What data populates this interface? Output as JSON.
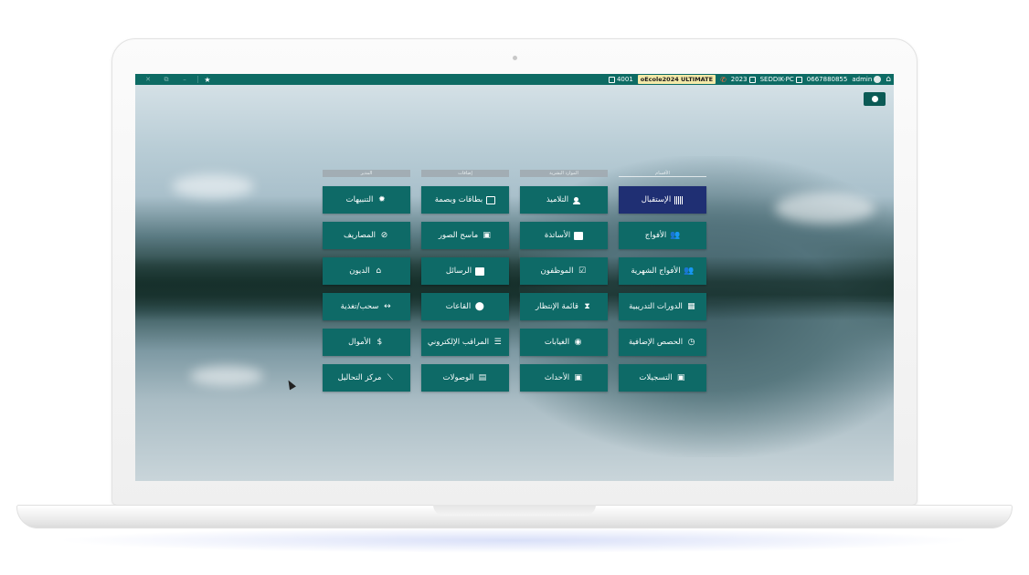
{
  "topbar": {
    "window_controls": [
      "✕",
      "⧉",
      "–"
    ],
    "star": "★",
    "count": "4001",
    "product": "oEcole2024 ULTIMATE",
    "year": "2023",
    "computer": "SEDDIK-PC",
    "phone": "0667880855",
    "user": "admin",
    "home": "⌂"
  },
  "columns": [
    {
      "heading": "الأقسام",
      "tiles": [
        {
          "label": "الإستقبال",
          "icon": "barcode-icon",
          "glyph": ""
        },
        {
          "label": "الأفواج",
          "icon": "group-icon",
          "glyph": "👥"
        },
        {
          "label": "الأفواج الشهرية",
          "icon": "group-monthly-icon",
          "glyph": "👥"
        },
        {
          "label": "الدورات التدريبية",
          "icon": "grid-icon",
          "glyph": "▦"
        },
        {
          "label": "الحصص الإضافية",
          "icon": "clock-icon",
          "glyph": "◷"
        },
        {
          "label": "التسجيلات",
          "icon": "calendar-icon",
          "glyph": "▣"
        }
      ]
    },
    {
      "heading": "الموارد البشرية",
      "tiles": [
        {
          "label": "التلاميذ",
          "icon": "person-icon",
          "glyph": ""
        },
        {
          "label": "الأساتذة",
          "icon": "briefcase-icon",
          "glyph": "▬"
        },
        {
          "label": "الموظفون",
          "icon": "checklist-icon",
          "glyph": "☑"
        },
        {
          "label": "قائمة الإنتظار",
          "icon": "hourglass-icon",
          "glyph": "⧗"
        },
        {
          "label": "الغيابات",
          "icon": "record-icon",
          "glyph": "◉"
        },
        {
          "label": "الأحداث",
          "icon": "event-icon",
          "glyph": "▣"
        }
      ]
    },
    {
      "heading": "إضافات",
      "tiles": [
        {
          "label": "بطاقات وبصمة",
          "icon": "card-icon",
          "glyph": ""
        },
        {
          "label": "ماسح الصور",
          "icon": "portrait-icon",
          "glyph": "▣"
        },
        {
          "label": "الرسائل",
          "icon": "message-icon",
          "glyph": "▇"
        },
        {
          "label": "القاعات",
          "icon": "location-pin-icon",
          "glyph": "⬤"
        },
        {
          "label": "المراقب الإلكتروني",
          "icon": "server-icon",
          "glyph": "☰"
        },
        {
          "label": "الوصولات",
          "icon": "receipt-icon",
          "glyph": "▤"
        }
      ]
    },
    {
      "heading": "المدير",
      "tiles": [
        {
          "label": "التنبيهات",
          "icon": "alarm-icon",
          "glyph": "✹"
        },
        {
          "label": "المصاريف",
          "icon": "money-off-icon",
          "glyph": "⊘"
        },
        {
          "label": "الديون",
          "icon": "hand-coin-icon",
          "glyph": "⌂"
        },
        {
          "label": "سحب/تغذية",
          "icon": "arrows-horizontal-icon",
          "glyph": "↔"
        },
        {
          "label": "الأموال",
          "icon": "dollar-icon",
          "glyph": "$"
        },
        {
          "label": "مركز التحاليل",
          "icon": "line-chart-icon",
          "glyph": "⟋"
        }
      ]
    }
  ]
}
